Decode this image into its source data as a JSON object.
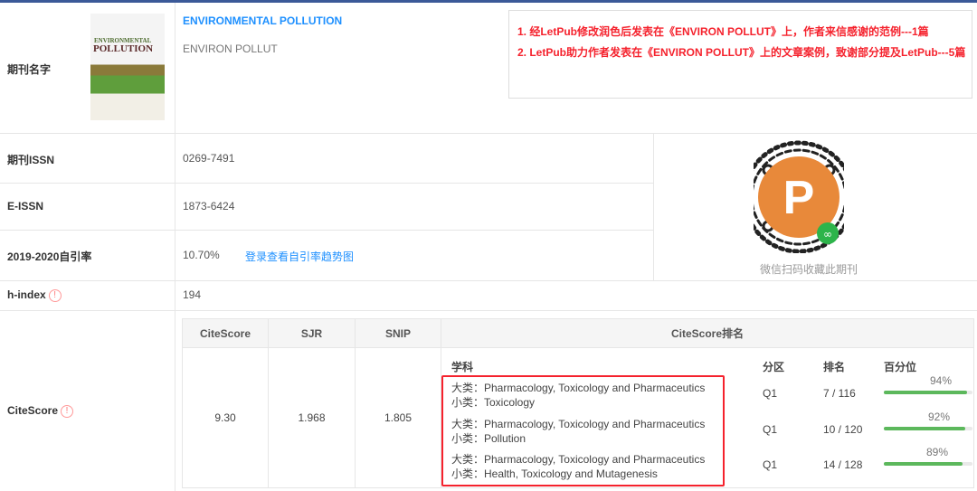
{
  "journal": {
    "label": "期刊名字",
    "full_name": "ENVIRONMENTAL POLLUTION",
    "abbr": "ENVIRON POLLUT",
    "cover_title_1": "ENVIRONMENTAL",
    "cover_title_2": "POLLUTION"
  },
  "notices": [
    "1. 经LetPub修改润色后发表在《ENVIRON POLLUT》上，作者来信感谢的范例---1篇",
    "2. LetPub助力作者发表在《ENVIRON POLLUT》上的文章案例，致谢部分提及LetPub---5篇"
  ],
  "issn": {
    "label": "期刊ISSN",
    "value": "0269-7491"
  },
  "eissn": {
    "label": "E-ISSN",
    "value": "1873-6424"
  },
  "self_cite": {
    "label": "2019-2020自引率",
    "value": "10.70%",
    "link": "登录查看自引率趋势图"
  },
  "hindex": {
    "label": "h-index",
    "value": "194"
  },
  "qr": {
    "caption": "微信扫码收藏此期刊",
    "logo_text": "LetPub"
  },
  "citescore": {
    "label": "CiteScore",
    "headers": [
      "CiteScore",
      "SJR",
      "SNIP",
      "CiteScore排名"
    ],
    "values": [
      "9.30",
      "1.968",
      "1.805"
    ],
    "rank_headers": [
      "学科",
      "分区",
      "排名",
      "百分位"
    ],
    "ranks": [
      {
        "major": "大类：Pharmacology, Toxicology and Pharmaceutics",
        "minor": "小类：Toxicology",
        "quartile": "Q1",
        "rank": "7 / 116",
        "percentile": "94%",
        "pct": 94
      },
      {
        "major": "大类：Pharmacology, Toxicology and Pharmaceutics",
        "minor": "小类：Pollution",
        "quartile": "Q1",
        "rank": "10 / 120",
        "percentile": "92%",
        "pct": 92
      },
      {
        "major": "大类：Pharmacology, Toxicology and Pharmaceutics",
        "minor": "小类：Health, Toxicology and Mutagenesis",
        "quartile": "Q1",
        "rank": "14 / 128",
        "percentile": "89%",
        "pct": 89
      }
    ]
  },
  "colors": {
    "link": "#1e90ff",
    "alert": "#f5222d",
    "bar": "#5cb85c"
  }
}
